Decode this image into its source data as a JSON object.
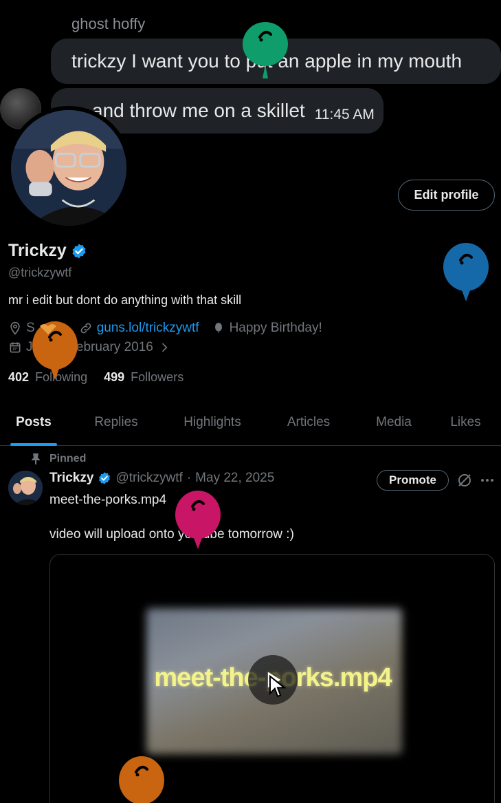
{
  "chat": {
    "sender": "ghost hoffy",
    "message1": "trickzy I want you to put an apple in my mouth",
    "message2": "and throw me on a skillet",
    "time": "11:45 AM"
  },
  "profile": {
    "edit_label": "Edit profile",
    "display_name": "Trickzy",
    "handle": "@trickzywtf",
    "bio": "mr i edit but dont do anything with that skill",
    "location": "S",
    "website": "guns.lol/trickzywtf",
    "birthday": "Happy Birthday!",
    "joined": "Joined February 2016",
    "following_count": "402",
    "following_label": "Following",
    "followers_count": "499",
    "followers_label": "Followers"
  },
  "tabs": [
    {
      "label": "Posts",
      "active": true
    },
    {
      "label": "Replies",
      "active": false
    },
    {
      "label": "Highlights",
      "active": false
    },
    {
      "label": "Articles",
      "active": false
    },
    {
      "label": "Media",
      "active": false
    },
    {
      "label": "Likes",
      "active": false
    }
  ],
  "post": {
    "pinned_label": "Pinned",
    "name": "Trickzy",
    "handle": "@trickzywtf",
    "separator": "·",
    "date": "May 22, 2025",
    "promote_label": "Promote",
    "line1": "meet-the-porks.mp4",
    "line2": "video will upload onto youtube tomorrow :)",
    "media_title": "meet-the-porks.mp4"
  },
  "colors": {
    "accent": "#1d9bf0",
    "balloon_green": "#0f9d6b",
    "balloon_blue": "#1569a8",
    "balloon_orange": "#c96410",
    "balloon_pink": "#c81566"
  },
  "icons": [
    "location-icon",
    "link-icon",
    "balloon-icon",
    "calendar-icon",
    "pin-icon",
    "verified-icon",
    "grok-icon",
    "more-icon",
    "play-icon"
  ]
}
